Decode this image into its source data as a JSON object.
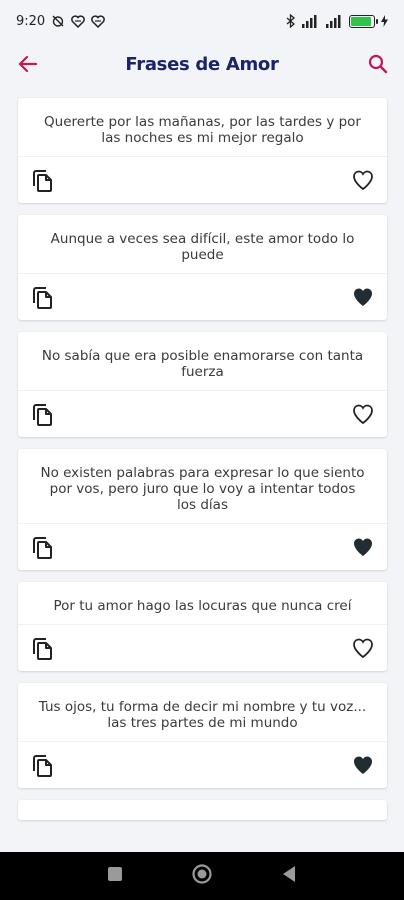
{
  "status_bar": {
    "time": "9:20",
    "battery_level": 0.85
  },
  "app_bar": {
    "title": "Frases de Amor",
    "accent_color": "#c2185b"
  },
  "phrases": [
    {
      "text": "Quererte por las mañanas, por las tardes y por las noches es mi mejor regalo",
      "favorite": false
    },
    {
      "text": "Aunque a veces sea difícil, este amor todo lo puede",
      "favorite": true
    },
    {
      "text": "No sabía que era posible enamorarse con tanta fuerza",
      "favorite": false
    },
    {
      "text": "No existen palabras para expresar lo que siento por vos, pero juro que lo voy a intentar todos los días",
      "favorite": true
    },
    {
      "text": "Por tu amor hago las locuras que nunca creí",
      "favorite": false
    },
    {
      "text": "Tus ojos, tu forma de decir mi nombre y tu voz... las tres partes de mi mundo",
      "favorite": true
    }
  ],
  "icons": {
    "back": "arrow-back-icon",
    "search": "search-icon",
    "copy": "copy-icon",
    "favorite_on": "heart-filled-icon",
    "favorite_off": "heart-outline-icon"
  }
}
